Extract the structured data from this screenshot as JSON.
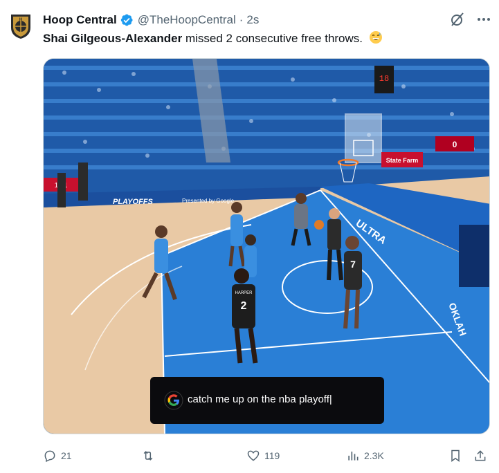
{
  "tweet": {
    "author_name": "Hoop Central",
    "handle": "@TheHoopCentral",
    "separator": "·",
    "time": "2s",
    "mention": "Shai Gilgeous-Alexander",
    "text_rest": " missed 2 consecutive free throws.",
    "emoji": "grinning-sweat-emoji"
  },
  "media": {
    "caption": "catch me up on the nba playoff|",
    "scene_labels": {
      "playoffs_banner": "PLAYOFFS",
      "presented_by": "Presented by Google",
      "ultra": "ULTRA",
      "statefarm": "State Farm",
      "okla": "OKLAH",
      "jersey_number": "2",
      "jersey_name": "HARPER",
      "jersey_number_2": "7",
      "score_box": "0",
      "shot_clock": "18",
      "left_score": "1 11"
    }
  },
  "actions": {
    "replies": "21",
    "reposts": "",
    "likes": "119",
    "views": "2.3K"
  },
  "colors": {
    "accent": "#1d9bf0",
    "text_secondary": "#536471",
    "court_blue": "#2a7fd6",
    "court_wood": "#e9c9a5"
  }
}
